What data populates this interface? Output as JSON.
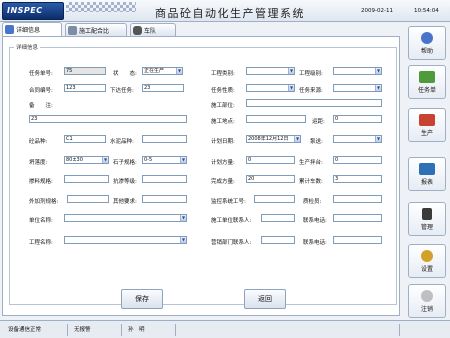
{
  "header": {
    "logo_text": "INSPEC",
    "title": "商品砼自动化生产管理系统",
    "date": "2009-02-11",
    "time": "10:54:04"
  },
  "tabs": [
    {
      "label": "详细信息"
    },
    {
      "label": "施工配合比"
    },
    {
      "label": "车队"
    }
  ],
  "section_title": "详细信息",
  "form": {
    "task_no": {
      "label": "任务单号:",
      "value": "75"
    },
    "status": {
      "label": "状　　态:",
      "value": "正在生产"
    },
    "contract_no": {
      "label": "合同编号:",
      "value": "123"
    },
    "sub_task": {
      "label": "下达任务:",
      "value": "23"
    },
    "remark": {
      "label": "备　　注:",
      "value": "23"
    },
    "project_type": {
      "label": "工程类别:",
      "value": ""
    },
    "project_level": {
      "label": "工程级别:",
      "value": ""
    },
    "task_nature": {
      "label": "任务性质:",
      "value": ""
    },
    "task_source": {
      "label": "任务来源:",
      "value": ""
    },
    "construction_part": {
      "label": "施工部位:",
      "value": ""
    },
    "construction_site": {
      "label": "施工地点:",
      "value": ""
    },
    "distance": {
      "label": "运距:",
      "value": "0"
    },
    "concrete_type": {
      "label": "砼品种:",
      "value": "C1"
    },
    "cement_type": {
      "label": "水泥品种:",
      "value": ""
    },
    "plan_date": {
      "label": "计划日期:",
      "value": "2008年12月12日"
    },
    "pump": {
      "label": "泵送:",
      "value": ""
    },
    "slump": {
      "label": "坍落度:",
      "value": "80±30"
    },
    "stone_spec": {
      "label": "石子规格:",
      "value": "0-5"
    },
    "plan_volume": {
      "label": "计划方量:",
      "value": "0"
    },
    "production_station": {
      "label": "生产拌台:",
      "value": "0"
    },
    "admixture_spec": {
      "label": "掺料规格:",
      "value": ""
    },
    "impermeability": {
      "label": "抗渗等级:",
      "value": ""
    },
    "completed_volume": {
      "label": "完成方量:",
      "value": "20"
    },
    "cumulative_trips": {
      "label": "累计车数:",
      "value": "3"
    },
    "additive_spec": {
      "label": "外加剂规格:",
      "value": ""
    },
    "other_req": {
      "label": "其他要求:",
      "value": ""
    },
    "supervisor_no": {
      "label": "监控系统工号:",
      "value": ""
    },
    "quality_inspector": {
      "label": "质检员:",
      "value": ""
    },
    "unit_name": {
      "label": "单位名称:",
      "value": ""
    },
    "site_contact": {
      "label": "施工单位联系人:",
      "value": ""
    },
    "contact_phone1": {
      "label": "联系电话:",
      "value": ""
    },
    "project_name": {
      "label": "工程名称:",
      "value": ""
    },
    "sales_contact": {
      "label": "营销部门联系人:",
      "value": ""
    },
    "contact_phone2": {
      "label": "联系电话:",
      "value": ""
    }
  },
  "buttons": {
    "save": "保存",
    "back": "返回"
  },
  "sidebar": [
    {
      "label": "帮助",
      "icon": "help-icon",
      "color": "#4a74c9"
    },
    {
      "label": "任务单",
      "icon": "task-list-icon",
      "color": "#4f9a3a"
    },
    {
      "label": "生产",
      "icon": "production-icon",
      "color": "#c8432f"
    },
    {
      "label": "报表",
      "icon": "report-icon",
      "color": "#2f6fb5"
    },
    {
      "label": "管理",
      "icon": "manage-icon",
      "color": "#3a3a3a"
    },
    {
      "label": "设置",
      "icon": "settings-icon",
      "color": "#d2a12a"
    },
    {
      "label": "注销",
      "icon": "logout-icon",
      "color": "#999999"
    }
  ],
  "statusbar": {
    "comm": "设备通信正常",
    "alarm": "无报警",
    "user": "孙　明"
  }
}
